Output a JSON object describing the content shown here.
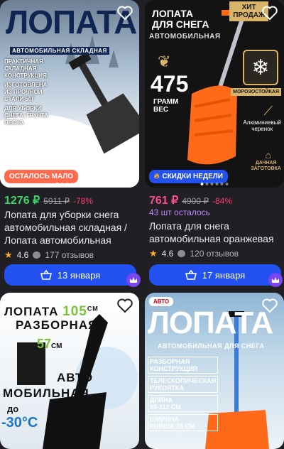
{
  "cards": [
    {
      "image": {
        "headline": "ЛОПАТА",
        "subheadline": "АВТОМОБИЛЬНАЯ СКЛАДНАЯ",
        "features": [
          "ПРАКТИЧНАЯ",
          "СКЛАДНАЯ",
          "КОНСТРУКЦИЯ",
          "ИЗГОТОВЛЕНА",
          "ИЗ ПРОЧНОЙ",
          "СТАЛИ 50Г",
          "ДЛЯ УБОРКИ",
          "СНЕГА, ГРУНТА",
          "ПЕСКА"
        ],
        "badge": "ОСТАЛОСЬ МАЛО"
      },
      "price": "1276 ₽",
      "old_price": "5911 ₽",
      "discount": "-78%",
      "title": "Лопата для уборки снега автомобильная складная / Лопата автомобильная для...",
      "rating": "4.6",
      "reviews": "177 отзывов",
      "delivery": "13 января"
    },
    {
      "image": {
        "headline_1": "ЛОПАТА",
        "headline_2": "ДЛЯ СНЕГА",
        "subheadline": "АВТОМОБИЛЬНАЯ",
        "hit_1": "ХИТ",
        "hit_2": "ПРОДАЖ",
        "weight_value": "475",
        "weight_label_1": "ГРАММ",
        "weight_label_2": "ВЕС",
        "frost": "МОРОЗОСТОЙКАЯ",
        "handle_1": "Алюминиевый",
        "handle_2": "черенок",
        "brand_1": "ДАЧНАЯ",
        "brand_2": "ЗАГОТОВКА",
        "badge": "СКИДКИ НЕДЕЛИ"
      },
      "price": "761 ₽",
      "old_price": "4900 ₽",
      "discount": "-84%",
      "stock": "43 шт осталось",
      "title": "Лопата для снега автомобильная оранжевая",
      "rating": "4.6",
      "reviews": "120 отзывов",
      "delivery": "17 января"
    },
    {
      "image": {
        "line_1": "ЛОПАТА",
        "size_1": "105",
        "unit_1": "СМ",
        "line_2": "РАЗБОРНАЯ",
        "size_2": "57",
        "unit_2": "СМ",
        "line_3": "АВТО",
        "line_4": "МОБИЛЬНАЯ",
        "line_5": "до",
        "temp": "-30°С"
      }
    },
    {
      "image": {
        "headline": "ЛОПАТА",
        "subheadline": "АВТОМОБИЛЬНАЯ ДЛЯ СНЕГА",
        "logo_text": "АВТО",
        "features": [
          "РАЗБОРНАЯ",
          "КОНСТРУКЦИЯ",
          "ТЕЛЕСКОПИЧЕСКАЯ",
          "РУКОЯТКА",
          "ДЛИНА",
          "93-112 СМ",
          "ШИРИНА",
          "КОВША 25 СМ"
        ]
      }
    }
  ],
  "colors": {
    "accent_blue": "#2251f0",
    "price_green": "#3fd46b",
    "price_pink": "#ff4d8a",
    "discount_red": "#ff3b6e",
    "stock_purple": "#c784ff"
  }
}
